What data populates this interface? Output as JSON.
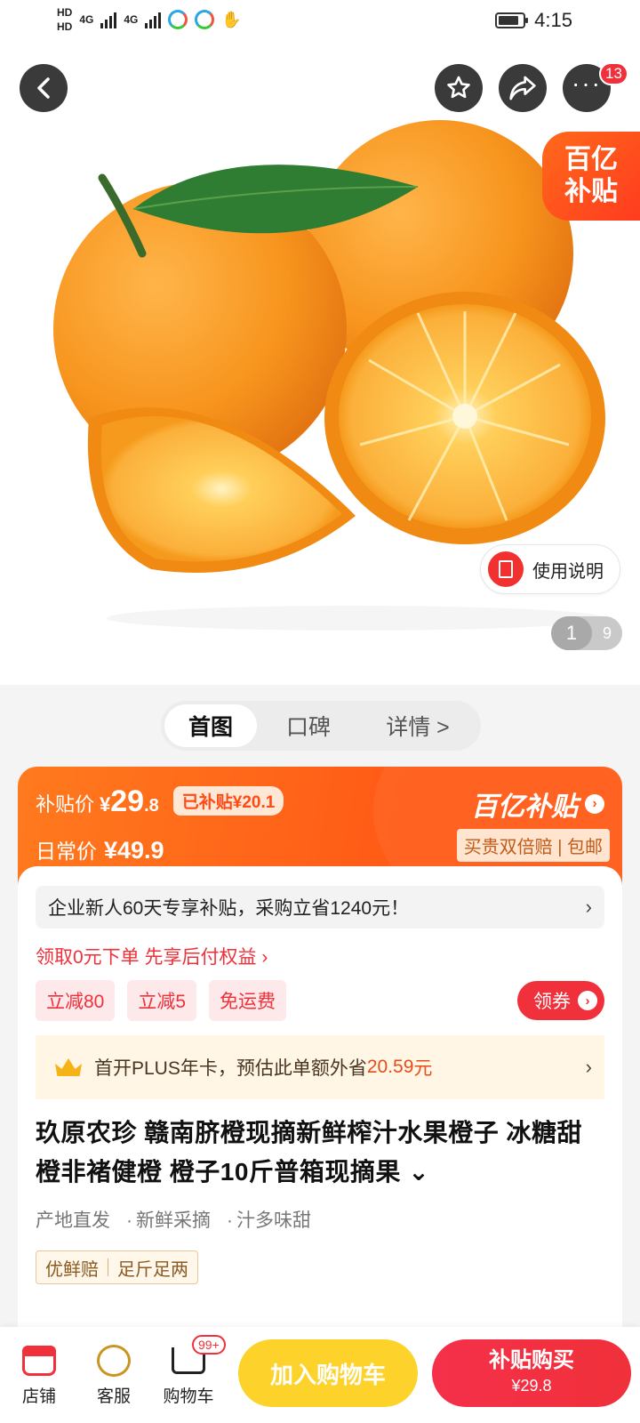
{
  "status_bar": {
    "hd1": "HD",
    "hd2": "HD",
    "net1": "4G",
    "net2": "4G",
    "time": "4:15"
  },
  "hero": {
    "badge_count": "13",
    "subsidy_tag_line1": "百亿",
    "subsidy_tag_line2": "补贴",
    "guide_label": "使用说明",
    "pager_current": "1",
    "pager_total": "9",
    "colors": {
      "orange_peel": "#f7941d",
      "orange_flesh": "#fbb03b",
      "leaf": "#2e7d32"
    }
  },
  "tabs": [
    {
      "label": "首图"
    },
    {
      "label": "口碑"
    },
    {
      "label": "详情 >"
    }
  ],
  "price": {
    "subsidy_label": "补贴价",
    "yen": "¥",
    "int": "29",
    "dec": ".8",
    "saved_chip": "已补贴¥20.1",
    "daily_label": "日常价",
    "daily_value": "¥49.9",
    "brand": "百亿补贴",
    "guarantee": "买贵双倍赔 | 包邮"
  },
  "promo": {
    "enterprise_text": "企业新人60天专享补贴，采购立省1240元！",
    "pay_later": "领取0元下单 先享后付权益 ›",
    "coupons": [
      "立减80",
      "立减5",
      "免运费"
    ],
    "get_coupon": "领券",
    "plus_prefix": "首开PLUS年卡，预估此单额外省",
    "plus_amount": "20.59",
    "plus_suffix": "元"
  },
  "product": {
    "title": "玖原农珍 赣南脐橙现摘新鲜榨汁水果橙子 冰糖甜橙非褚健橙 橙子10斤普箱现摘果 ⌄",
    "tags": [
      "产地直发",
      "新鲜采摘",
      "汁多味甜"
    ],
    "quality": [
      "优鲜赔",
      "足斤足两"
    ]
  },
  "bottom": {
    "store": "店铺",
    "service": "客服",
    "cart": "购物车",
    "cart_badge": "99+",
    "add_cart": "加入购物车",
    "buy_line1": "补贴购买",
    "buy_line2": "¥29.8"
  },
  "colors": {
    "accent_red": "#f0303a",
    "subsidy_orange": "#ff5a16",
    "cart_yellow": "#fdd22a"
  }
}
